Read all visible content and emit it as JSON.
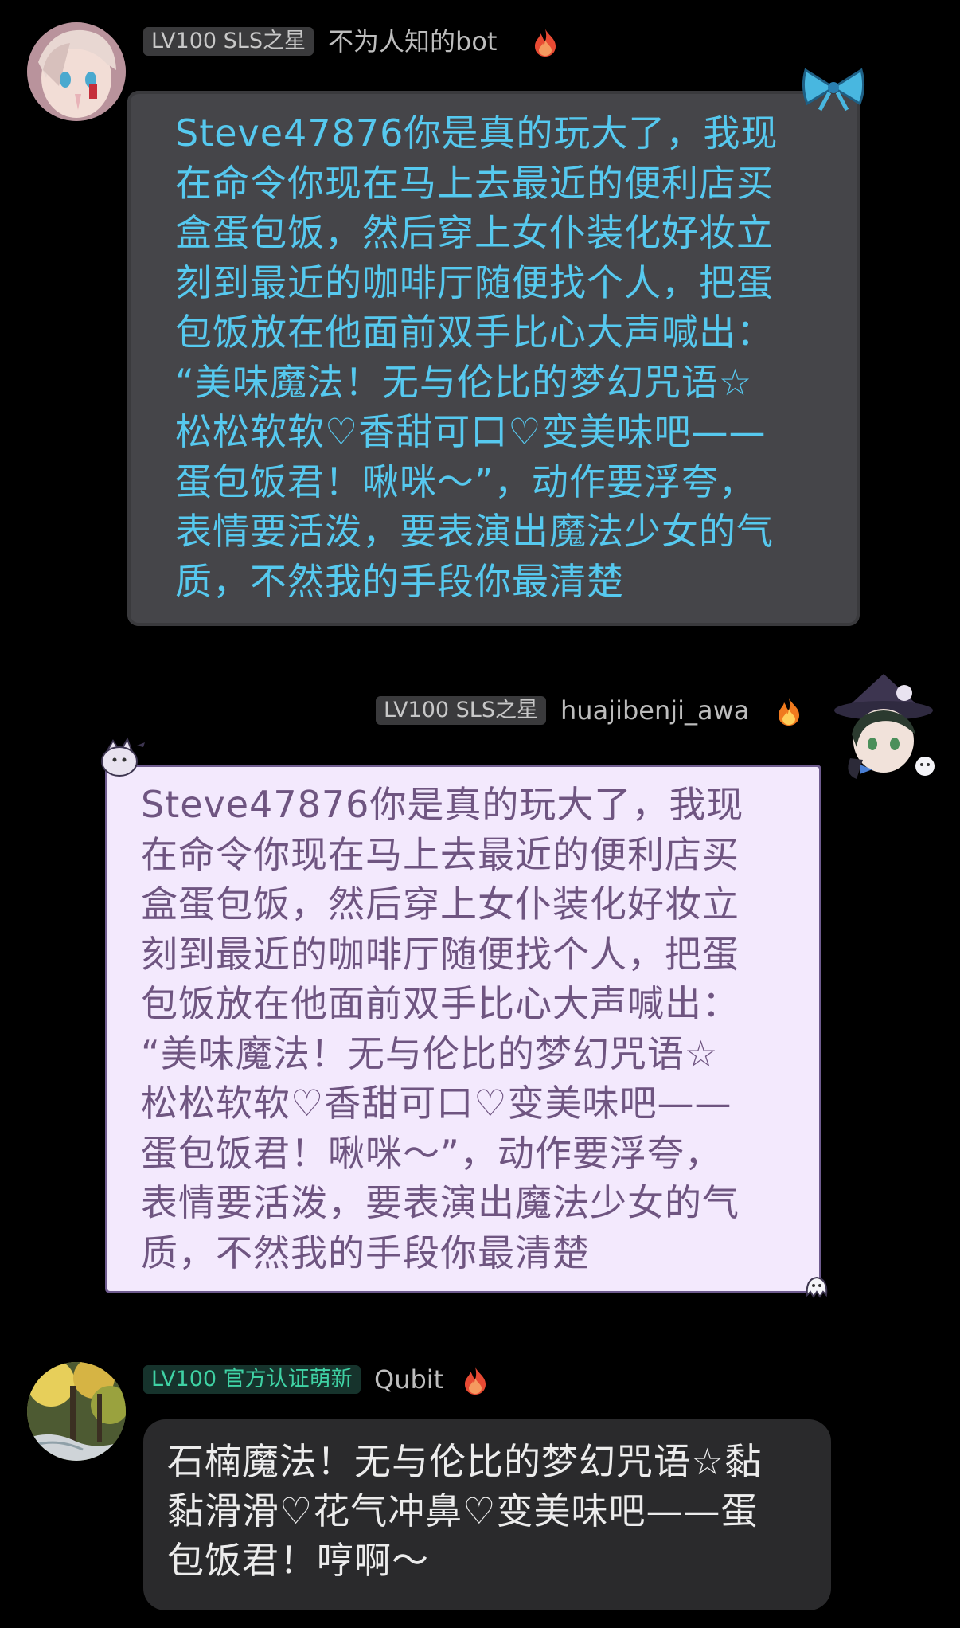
{
  "messages": [
    {
      "sender": "不为人知的bot",
      "level_badge": "LV100 SLS之星",
      "text": "Steve47876你是真的玩大了，我现\n在命令你现在马上去最近的便利店买\n盒蛋包饭，然后穿上女仆装化好妆立\n刻到最近的咖啡厅随便找个人，把蛋\n包饭放在他面前双手比心大声喊出：\n“美味魔法！无与伦比的梦幻咒语☆\n松松软软♡香甜可口♡变美味吧——\n蛋包饭君！啾咪～”，动作要浮夸，\n表情要活泼，要表演出魔法少女的气\n质，不然我的手段你最清楚",
      "text_color": "#56c9ef",
      "bubble_color": "#454549",
      "badge_icon": "fire-icon"
    },
    {
      "sender": "huajibenji_awa",
      "level_badge": "LV100 SLS之星",
      "text": "Steve47876你是真的玩大了，我现\n在命令你现在马上去最近的便利店买\n盒蛋包饭，然后穿上女仆装化好妆立\n刻到最近的咖啡厅随便找个人，把蛋\n包饭放在他面前双手比心大声喊出：\n“美味魔法！无与伦比的梦幻咒语☆\n松松软软♡香甜可口♡变美味吧——\n蛋包饭君！啾咪～”，动作要浮夸，\n表情要活泼，要表演出魔法少女的气\n质，不然我的手段你最清楚",
      "text_color": "#6f5581",
      "bubble_color": "#f3e9fd",
      "badge_icon": "fire-icon"
    },
    {
      "sender": "Qubit",
      "level_badge": "LV100 官方认证萌新",
      "text": "石楠魔法！无与伦比的梦幻咒语☆黏\n黏滑滑♡花气冲鼻♡变美味吧——蛋\n包饭君！哼啊～",
      "text_color": "#ececec",
      "bubble_color": "#2a2a2c",
      "badge_icon": "fire-icon"
    }
  ]
}
